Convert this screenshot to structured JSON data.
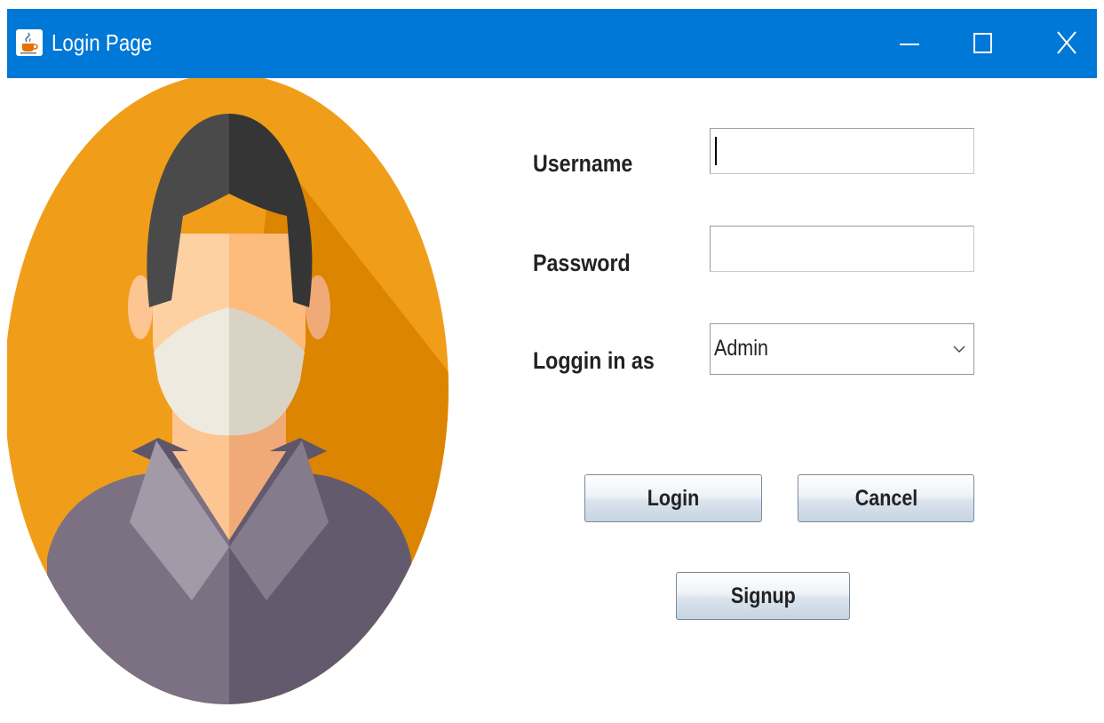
{
  "window": {
    "title": "Login Page",
    "app_icon": "java-coffee-cup-icon",
    "controls": {
      "minimize_icon": "minimize-icon",
      "maximize_icon": "maximize-icon",
      "close_icon": "close-icon"
    },
    "titlebar_color": "#0078d7"
  },
  "avatar": {
    "icon": "user-with-face-mask-icon",
    "background_color": "#f09e19"
  },
  "form": {
    "username_label": "Username",
    "username_value": "",
    "password_label": "Password",
    "password_value": "",
    "role_label": "Loggin in as",
    "role_selected": "Admin"
  },
  "buttons": {
    "login": "Login",
    "cancel": "Cancel",
    "signup": "Signup"
  }
}
